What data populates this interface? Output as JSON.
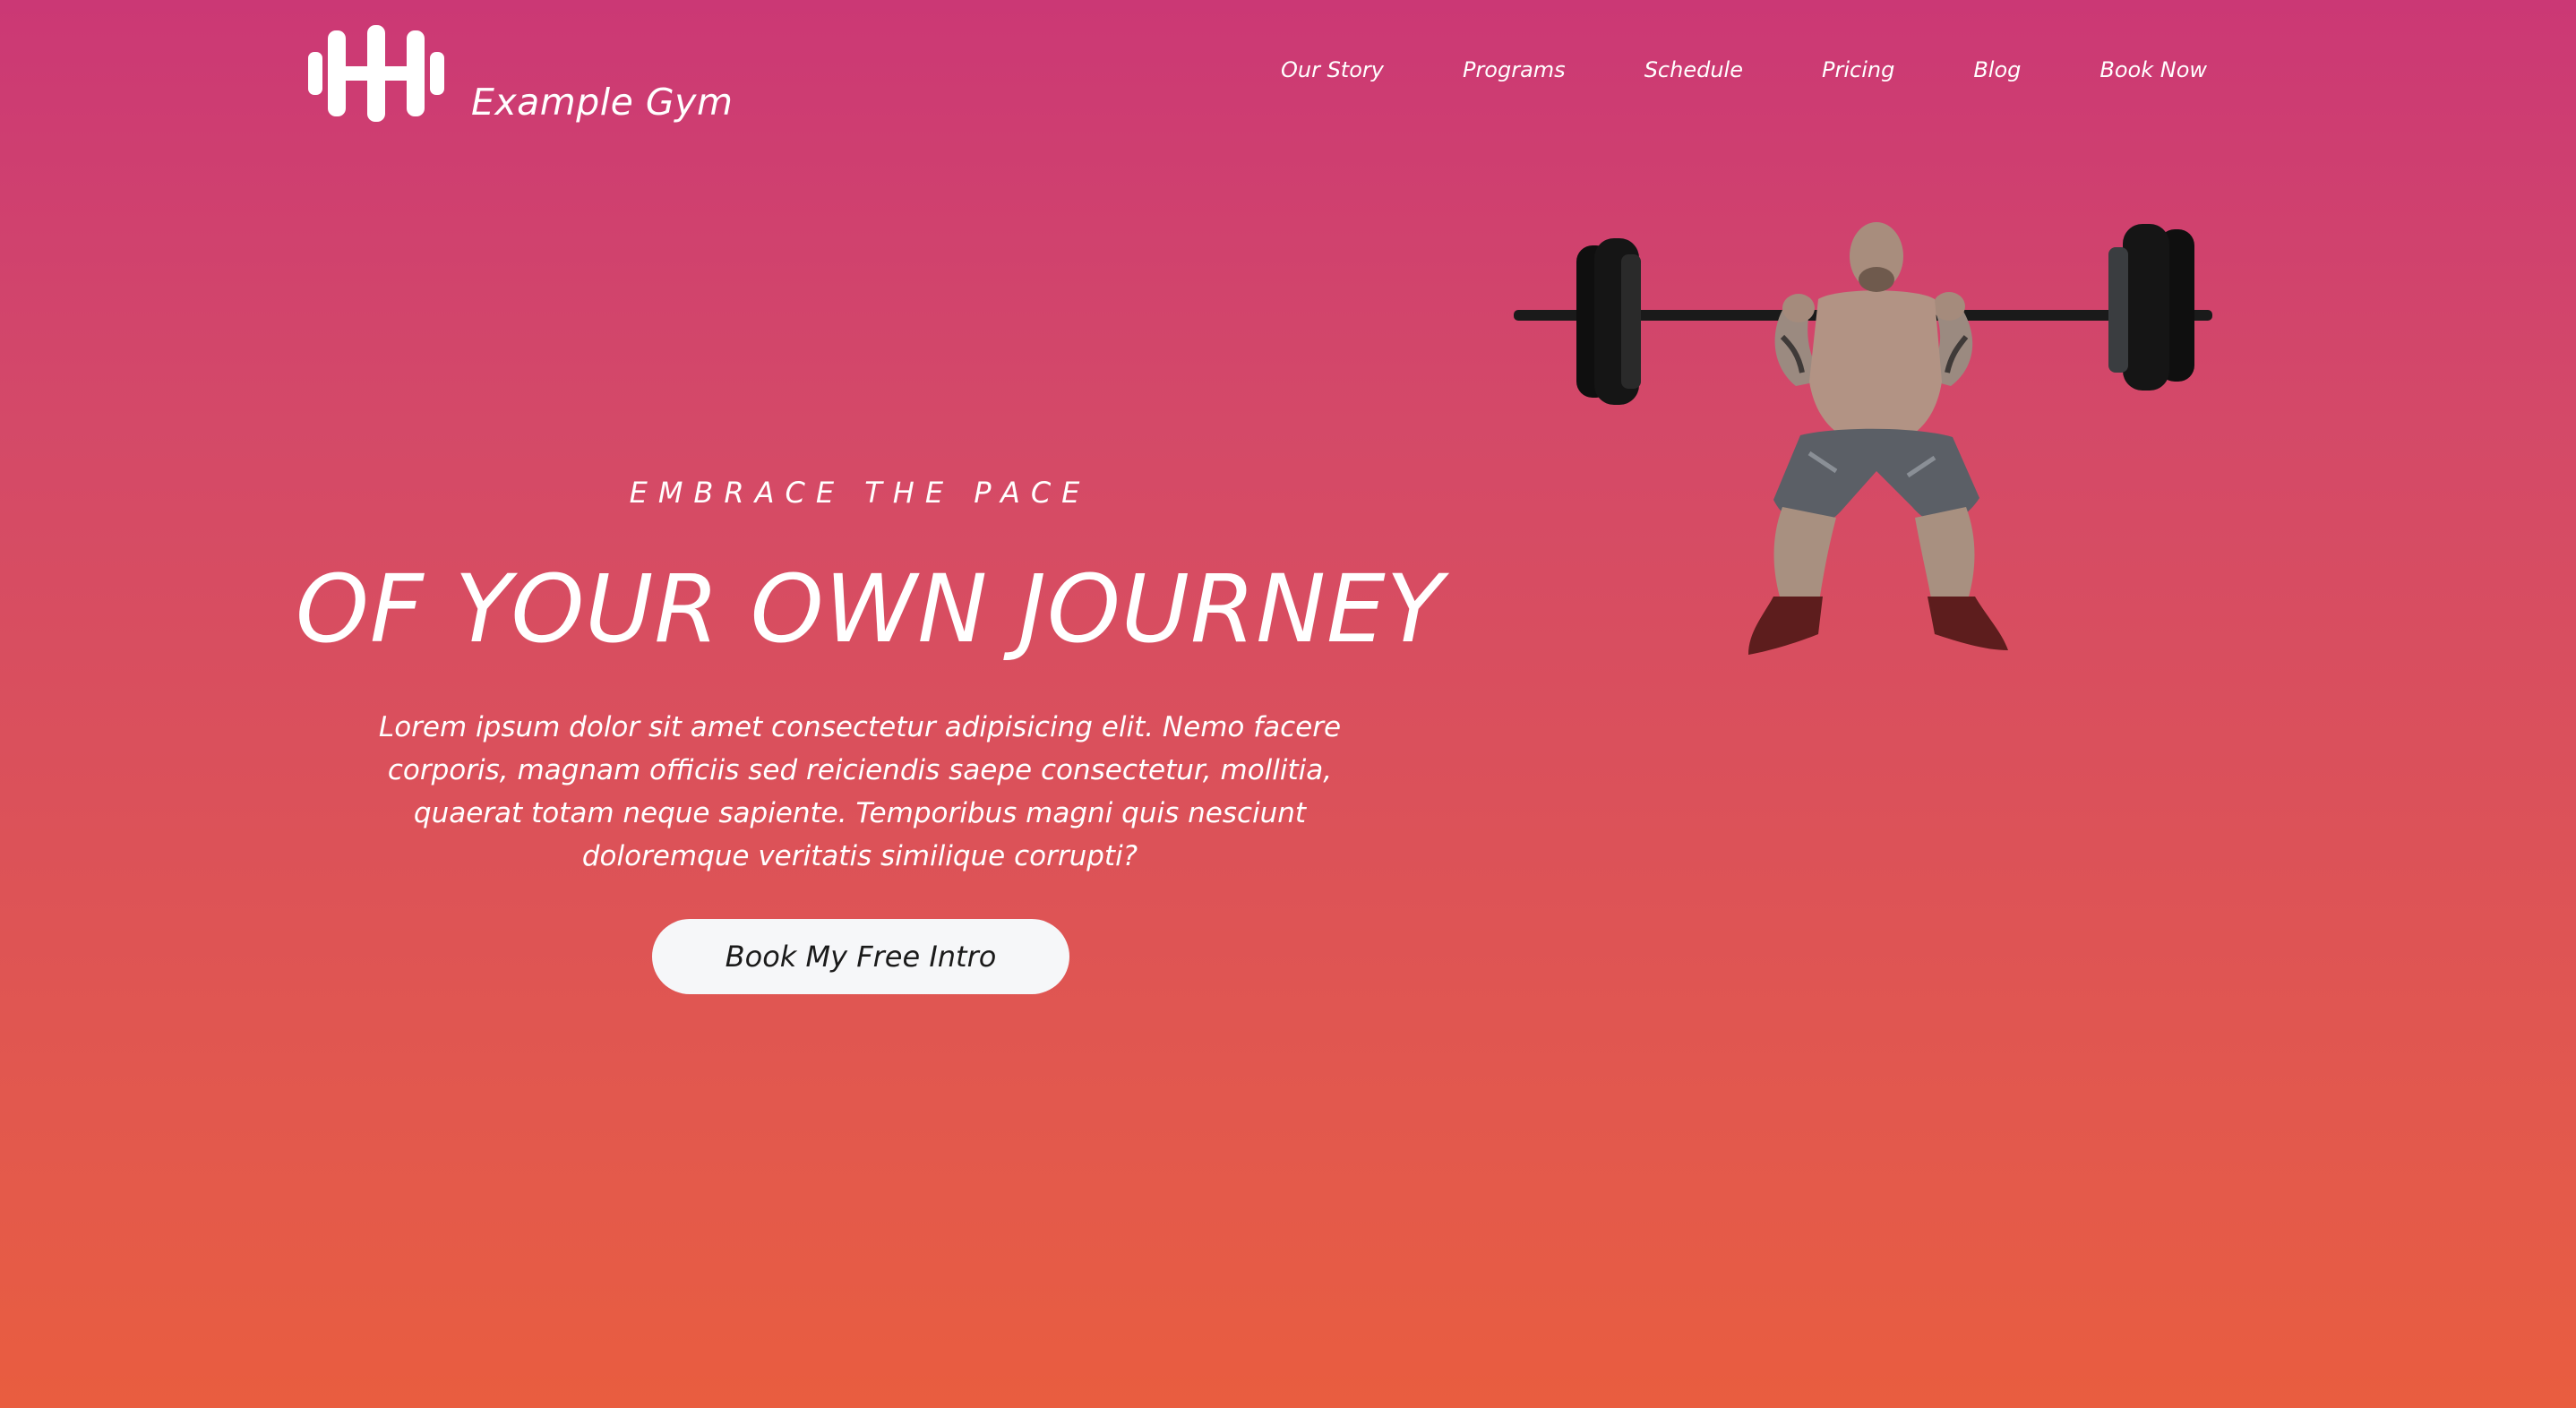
{
  "brand": {
    "name": "Example Gym",
    "logo_icon": "dumbbell-icon"
  },
  "nav": {
    "items": [
      {
        "label": "Our Story"
      },
      {
        "label": "Programs"
      },
      {
        "label": "Schedule"
      },
      {
        "label": "Pricing"
      },
      {
        "label": "Blog"
      },
      {
        "label": "Book Now"
      }
    ]
  },
  "hero": {
    "eyebrow": "EMBRACE THE PACE",
    "headline": "OF YOUR OWN JOURNEY",
    "body": "Lorem ipsum dolor sit amet consectetur adipisicing elit. Nemo facere corporis, magnam officiis sed reiciendis saepe consectetur, mollitia, quaerat totam neque sapiente. Temporibus magni quis nesciunt doloremque veritatis similique corrupti?",
    "cta_label": "Book My Free Intro"
  },
  "colors": {
    "gradient_top": "#cb3875",
    "gradient_bottom": "#e95d3f",
    "text": "#ffffff",
    "button_bg": "#f6f7f9",
    "button_text": "#1b1b1b"
  },
  "image": {
    "subject": "weightlifter-squat-image"
  }
}
